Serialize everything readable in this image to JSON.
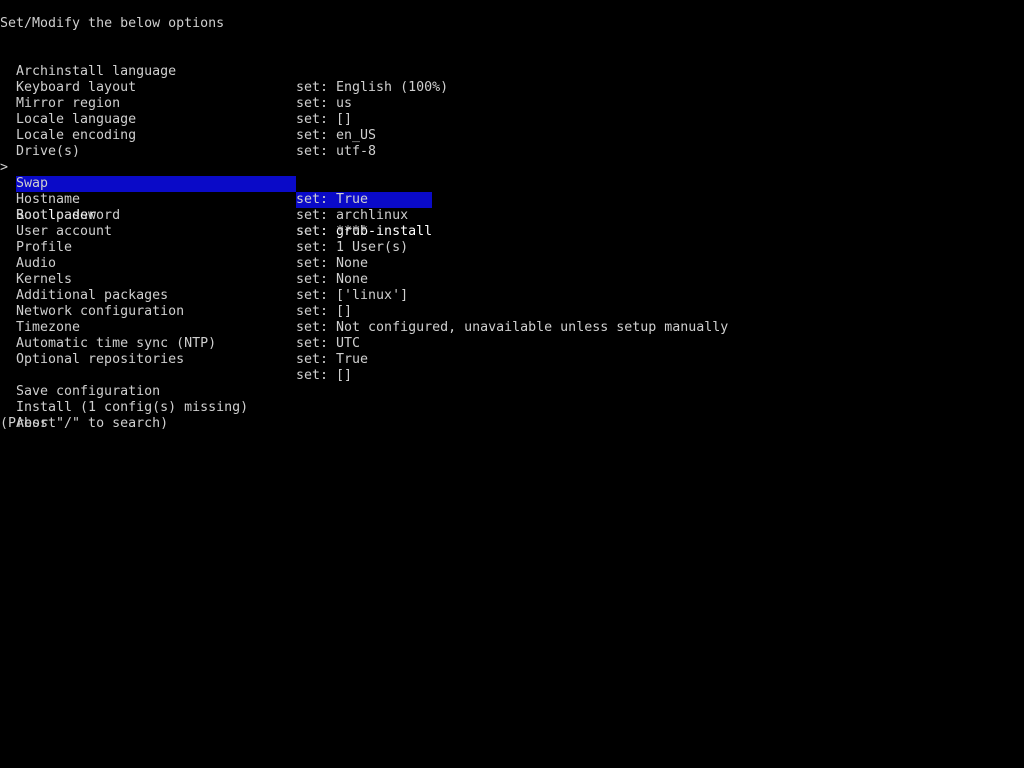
{
  "header": "Set/Modify the below options",
  "cursor_symbol": ">",
  "selected_index": 6,
  "options": [
    {
      "label": "Archinstall language",
      "value": "set: English (100%)"
    },
    {
      "label": "Keyboard layout",
      "value": "set: us"
    },
    {
      "label": "Mirror region",
      "value": "set: []"
    },
    {
      "label": "Locale language",
      "value": "set: en_US"
    },
    {
      "label": "Locale encoding",
      "value": "set: utf-8"
    },
    {
      "label": "Drive(s)",
      "value": ""
    },
    {
      "label": "Bootloader",
      "value": "set: grub-install"
    },
    {
      "label": "Swap",
      "value": "set: True"
    },
    {
      "label": "Hostname",
      "value": "set: archlinux"
    },
    {
      "label": "Root password",
      "value": "set: ****"
    },
    {
      "label": "User account",
      "value": "set: 1 User(s)"
    },
    {
      "label": "Profile",
      "value": "set: None"
    },
    {
      "label": "Audio",
      "value": "set: None"
    },
    {
      "label": "Kernels",
      "value": "set: ['linux']"
    },
    {
      "label": "Additional packages",
      "value": "set: []"
    },
    {
      "label": "Network configuration",
      "value": "set: Not configured, unavailable unless setup manually"
    },
    {
      "label": "Timezone",
      "value": "set: UTC"
    },
    {
      "label": "Automatic time sync (NTP)",
      "value": "set: True"
    },
    {
      "label": "Optional repositories",
      "value": "set: []"
    }
  ],
  "actions": [
    {
      "label": "Save configuration"
    },
    {
      "label": "Install (1 config(s) missing)"
    },
    {
      "label": "Abort"
    }
  ],
  "search_hint": "(Press \"/\" to search)",
  "colors": {
    "background": "#000000",
    "text": "#cfcfcf",
    "highlight_bg": "#0a0ac8",
    "highlight_text": "#ffffff"
  }
}
